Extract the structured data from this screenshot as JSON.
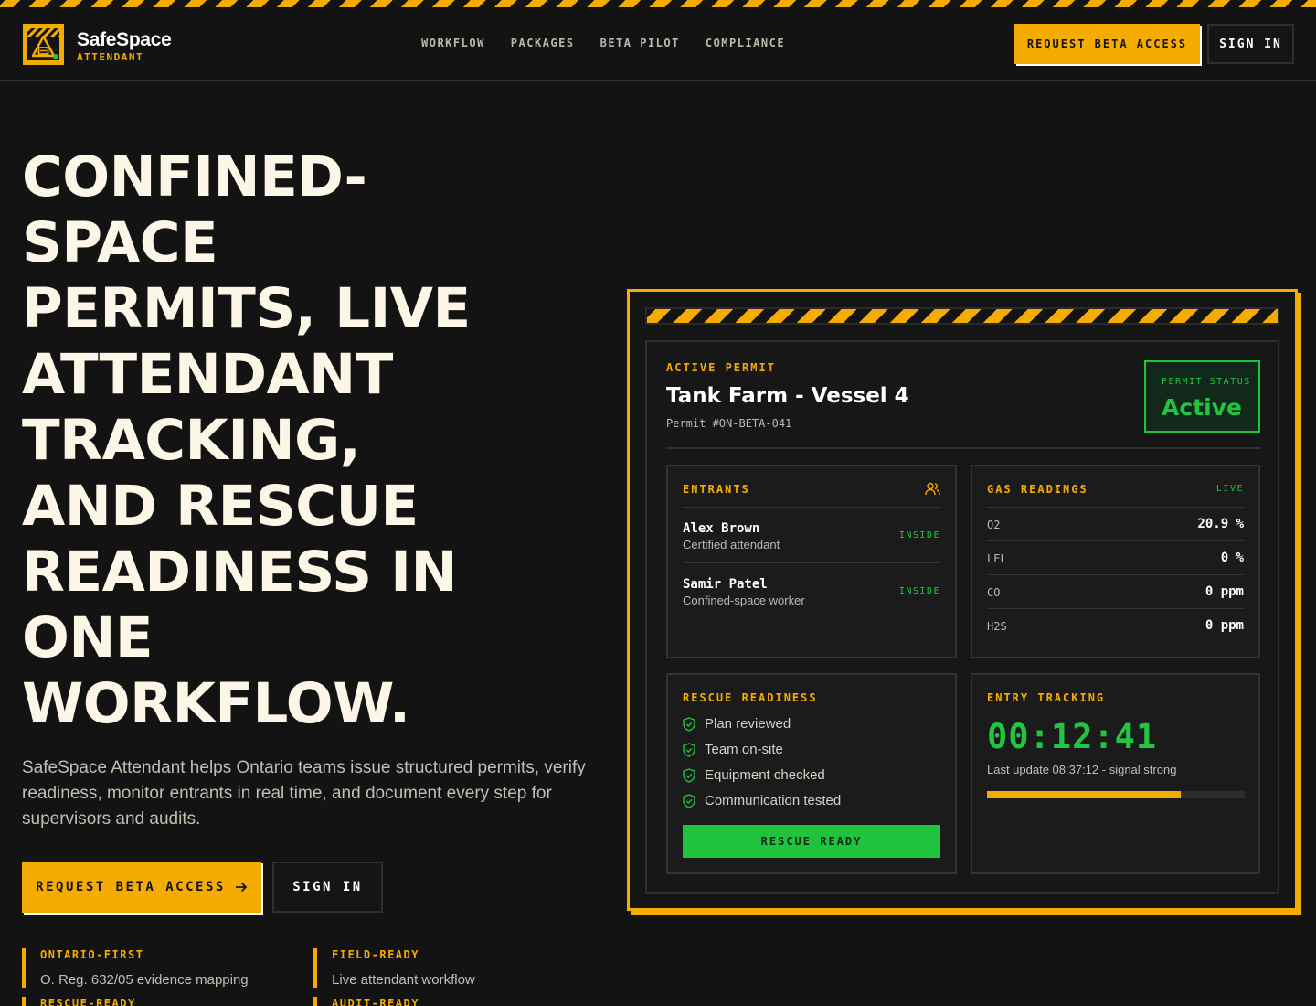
{
  "header": {
    "brand": "SafeSpace",
    "brand_sub": "ATTENDANT",
    "nav": [
      "WORKFLOW",
      "PACKAGES",
      "BETA PILOT",
      "COMPLIANCE"
    ],
    "request_label": "REQUEST BETA ACCESS",
    "signin_label": "SIGN IN"
  },
  "hero": {
    "title_lines": [
      "CONFINED-",
      "SPACE",
      "PERMITS, LIVE",
      "ATTENDANT",
      "TRACKING,",
      "AND RESCUE",
      "READINESS IN",
      "ONE",
      "WORKFLOW."
    ],
    "description": "SafeSpace Attendant helps Ontario teams issue structured permits, verify readiness, monitor entrants in real time, and document every step for supervisors and audits.",
    "cta_primary": "REQUEST BETA ACCESS",
    "cta_secondary": "SIGN IN",
    "features": [
      {
        "title": "ONTARIO-FIRST",
        "desc": "O. Reg. 632/05 evidence mapping"
      },
      {
        "title": "FIELD-READY",
        "desc": "Live attendant workflow"
      },
      {
        "title": "RESCUE-READY",
        "desc": ""
      },
      {
        "title": "AUDIT-READY",
        "desc": ""
      }
    ]
  },
  "permit": {
    "label": "ACTIVE PERMIT",
    "title": "Tank Farm - Vessel 4",
    "number": "Permit #ON-BETA-041",
    "status_label": "PERMIT STATUS",
    "status_value": "Active"
  },
  "entrants": {
    "label": "ENTRANTS",
    "items": [
      {
        "name": "Alex Brown",
        "role": "Certified attendant",
        "status": "INSIDE"
      },
      {
        "name": "Samir Patel",
        "role": "Confined-space worker",
        "status": "INSIDE"
      }
    ]
  },
  "gas": {
    "label": "GAS READINGS",
    "badge": "LIVE",
    "readings": [
      {
        "name": "O2",
        "value": "20.9 %"
      },
      {
        "name": "LEL",
        "value": "0 %"
      },
      {
        "name": "CO",
        "value": "0 ppm"
      },
      {
        "name": "H2S",
        "value": "0 ppm"
      }
    ]
  },
  "rescue": {
    "label": "RESCUE READINESS",
    "items": [
      "Plan reviewed",
      "Team on-site",
      "Equipment checked",
      "Communication tested"
    ],
    "button": "RESCUE READY"
  },
  "tracking": {
    "label": "ENTRY TRACKING",
    "timer": "00:12:41",
    "last_update": "Last update 08:37:12 - signal strong",
    "progress_percent": 75
  },
  "colors": {
    "accent": "#f5ac00",
    "success": "#22c443",
    "background": "#131313"
  }
}
